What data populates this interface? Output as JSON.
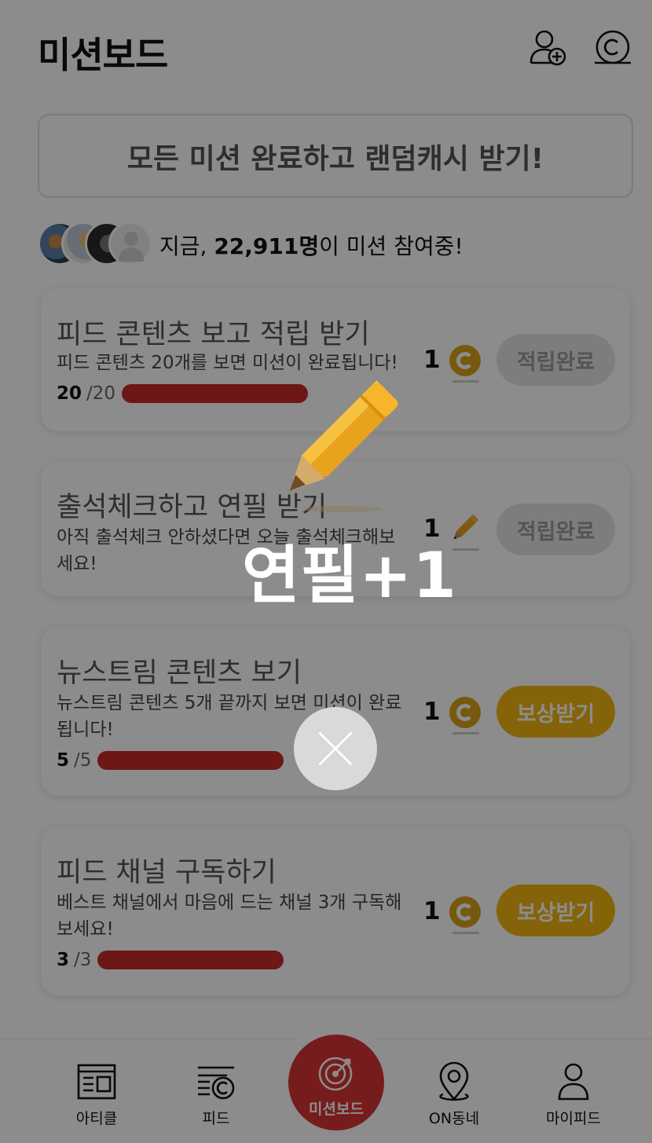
{
  "header": {
    "title": "미션보드",
    "icons": [
      "add-friend-icon",
      "cash-coin-icon"
    ]
  },
  "banner": {
    "text": "모든 미션 완료하고 랜덤캐시 받기!"
  },
  "participants": {
    "prefix": "지금, ",
    "count": "22,911명",
    "suffix": "이 미션 참여중!"
  },
  "missions": [
    {
      "title": "피드 콘텐츠 보고 적립 받기",
      "desc": "피드 콘텐츠 20개를 보면 미션이 완료됩니다!",
      "progress_current": "20",
      "progress_total": "/20",
      "progress_ratio": 1.0,
      "reward_amount": "1",
      "reward_icon": "coin-icon",
      "button": "적립완료",
      "button_state": "done"
    },
    {
      "title": "출석체크하고 연필 받기",
      "desc": "아직 출석체크 안하셨다면 오늘 출석체크해보세요!",
      "reward_amount": "1",
      "reward_icon": "pencil-icon",
      "button": "적립완료",
      "button_state": "done"
    },
    {
      "title": "뉴스트림 콘텐츠 보기",
      "desc": "뉴스트림 콘텐츠 5개 끝까지 보면 미션이 완료됩니다!",
      "progress_current": "5",
      "progress_total": "/5",
      "progress_ratio": 1.0,
      "reward_amount": "1",
      "reward_icon": "coin-icon",
      "button": "보상받기",
      "button_state": "claim"
    },
    {
      "title": "피드 채널 구독하기",
      "desc": "베스트 채널에서 마음에 드는 채널 3개 구독해보세요!",
      "progress_current": "3",
      "progress_total": "/3",
      "progress_ratio": 1.0,
      "reward_amount": "1",
      "reward_icon": "coin-icon",
      "button": "보상받기",
      "button_state": "claim"
    }
  ],
  "nav": {
    "items": [
      {
        "label": "아티클",
        "icon": "article-icon"
      },
      {
        "label": "피드",
        "icon": "feed-icon"
      },
      {
        "label": "미션보드",
        "icon": "target-icon"
      },
      {
        "label": "ON동네",
        "icon": "location-pin-icon"
      },
      {
        "label": "마이피드",
        "icon": "person-icon"
      }
    ],
    "active": "미션보드"
  },
  "overlay": {
    "reward_text": "연필+1",
    "icon": "pencil-icon",
    "close_icon": "close-icon"
  },
  "colors": {
    "accent_red": "#d93333",
    "progress_red": "#c72a2a",
    "claim_yellow": "#f3b40f",
    "coin_gold": "#d9a21b",
    "dim_overlay": "rgba(0,0,0,0.45)"
  }
}
